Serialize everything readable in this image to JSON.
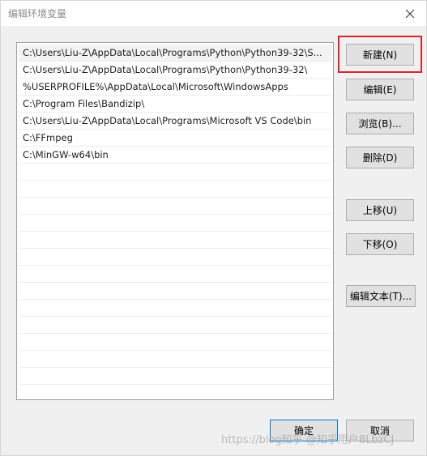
{
  "window": {
    "title": "编辑环境变量"
  },
  "paths": [
    "C:\\Users\\Liu-Z\\AppData\\Local\\Programs\\Python\\Python39-32\\S...",
    "C:\\Users\\Liu-Z\\AppData\\Local\\Programs\\Python\\Python39-32\\",
    "%USERPROFILE%\\AppData\\Local\\Microsoft\\WindowsApps",
    "C:\\Program Files\\Bandizip\\",
    "C:\\Users\\Liu-Z\\AppData\\Local\\Programs\\Microsoft VS Code\\bin",
    "C:\\FFmpeg",
    "C:\\MinGW-w64\\bin"
  ],
  "buttons": {
    "new": "新建(N)",
    "edit": "编辑(E)",
    "browse": "浏览(B)...",
    "delete": "删除(D)",
    "move_up": "上移(U)",
    "move_down": "下移(O)",
    "edit_text": "编辑文本(T)...",
    "ok": "确定",
    "cancel": "取消"
  },
  "watermark": "https://blog知乎 @知乎用户8LbzCJ",
  "icons": {
    "close": "close-icon"
  },
  "colors": {
    "highlight": "#d9262b",
    "focus": "#0078d7"
  }
}
